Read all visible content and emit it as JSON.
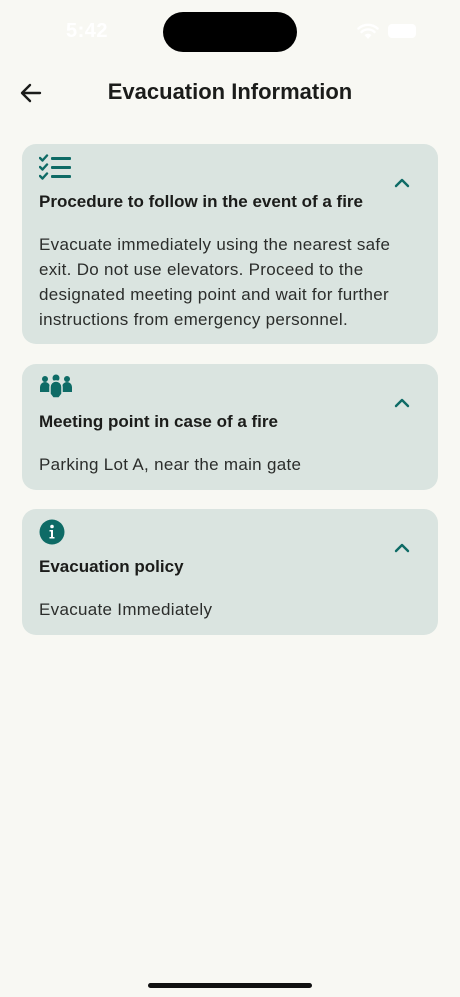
{
  "status_bar": {
    "time": "5:42"
  },
  "header": {
    "title": "Evacuation Information"
  },
  "sections": [
    {
      "icon": "checklist-icon",
      "title": "Procedure to follow in the event of a fire",
      "body": "Evacuate immediately using the nearest safe exit. Do not use elevators. Proceed to the designated meeting point and wait for further instructions from emergency personnel.",
      "expanded": true
    },
    {
      "icon": "group-icon",
      "title": "Meeting point in case of a fire",
      "body": "Parking Lot A, near the main gate",
      "expanded": true
    },
    {
      "icon": "info-icon",
      "title": "Evacuation policy",
      "body": "Evacuate Immediately",
      "expanded": true
    }
  ],
  "colors": {
    "background": "#f8f8f3",
    "card": "#dae4e0",
    "accent": "#0e6b66",
    "text": "#1b1c1a"
  }
}
